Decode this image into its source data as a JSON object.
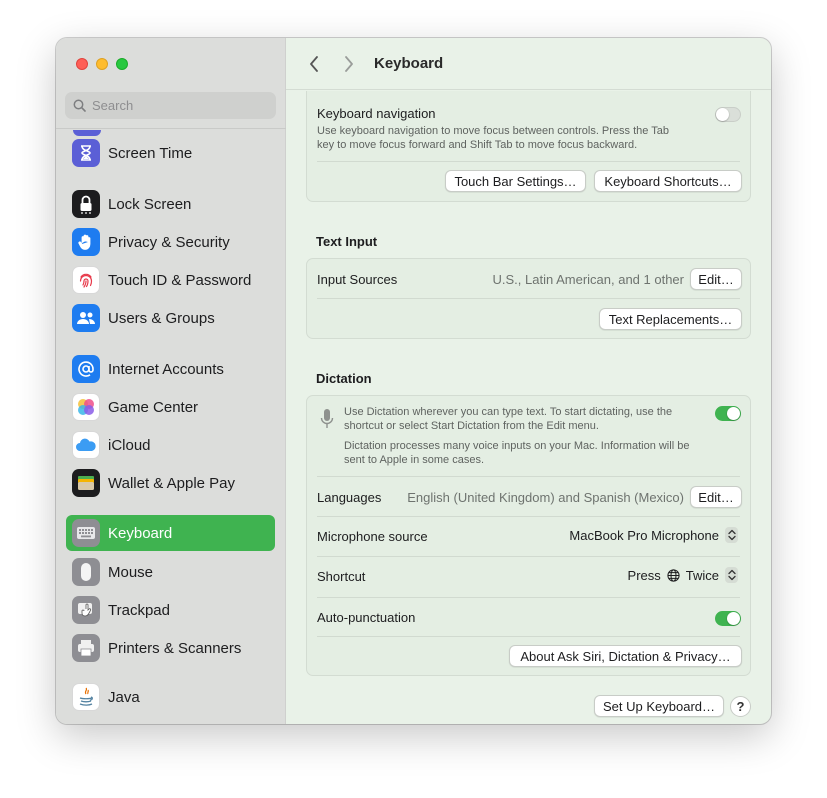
{
  "window": {
    "title": "Keyboard"
  },
  "search": {
    "placeholder": "Search"
  },
  "sidebar": {
    "items": [
      {
        "label": "Screen Time",
        "icon": "hourglass-icon",
        "color": "#5b5fd6"
      },
      {
        "label": "Lock Screen",
        "icon": "lock-icon",
        "color": "#1c1c1e"
      },
      {
        "label": "Privacy & Security",
        "icon": "hand-icon",
        "color": "#1e7cf0"
      },
      {
        "label": "Touch ID & Password",
        "icon": "fingerprint-icon",
        "color": "#ffffff"
      },
      {
        "label": "Users & Groups",
        "icon": "users-icon",
        "color": "#1e7cf0"
      },
      {
        "label": "Internet Accounts",
        "icon": "at-icon",
        "color": "#1e7cf0"
      },
      {
        "label": "Game Center",
        "icon": "game-center-icon",
        "color": "#ffffff"
      },
      {
        "label": "iCloud",
        "icon": "cloud-icon",
        "color": "#ffffff"
      },
      {
        "label": "Wallet & Apple Pay",
        "icon": "wallet-icon",
        "color": "#1c1c1e"
      },
      {
        "label": "Keyboard",
        "icon": "keyboard-icon",
        "color": "#8e8e93",
        "selected": true
      },
      {
        "label": "Mouse",
        "icon": "mouse-icon",
        "color": "#8e8e93"
      },
      {
        "label": "Trackpad",
        "icon": "trackpad-icon",
        "color": "#8e8e93"
      },
      {
        "label": "Printers & Scanners",
        "icon": "printer-icon",
        "color": "#8e8e93"
      },
      {
        "label": "Java",
        "icon": "java-icon",
        "color": "#ffffff"
      }
    ]
  },
  "keyboard_nav": {
    "title": "Keyboard navigation",
    "description_line1": "Use keyboard navigation to move focus between controls. Press the Tab",
    "description_line2": "key to move focus forward and Shift Tab to move focus backward.",
    "enabled": false,
    "touch_bar_button": "Touch Bar Settings…",
    "shortcuts_button": "Keyboard Shortcuts…"
  },
  "text_input": {
    "section_title": "Text Input",
    "input_sources_label": "Input Sources",
    "input_sources_value": "U.S., Latin American, and 1 other",
    "edit_button": "Edit…",
    "text_replacements_button": "Text Replacements…"
  },
  "dictation": {
    "section_title": "Dictation",
    "desc1_line1": "Use Dictation wherever you can type text. To start dictating, use the",
    "desc1_line2": "shortcut or select Start Dictation from the Edit menu.",
    "desc2_line1": "Dictation processes many voice inputs on your Mac. Information will be",
    "desc2_line2": "sent to Apple in some cases.",
    "enabled": true,
    "languages_label": "Languages",
    "languages_value": "English (United Kingdom) and Spanish (Mexico)",
    "languages_edit_button": "Edit…",
    "mic_label": "Microphone source",
    "mic_value": "MacBook Pro Microphone",
    "shortcut_label": "Shortcut",
    "shortcut_press": "Press",
    "shortcut_twice": "Twice",
    "autopunct_label": "Auto-punctuation",
    "autopunct_enabled": true,
    "about_button": "About Ask Siri, Dictation & Privacy…"
  },
  "footer": {
    "setup_button": "Set Up Keyboard…",
    "help_label": "?"
  },
  "colors": {
    "accent": "#3fb350",
    "background": "#e9f2e8",
    "sidebar": "#dcdddb"
  }
}
